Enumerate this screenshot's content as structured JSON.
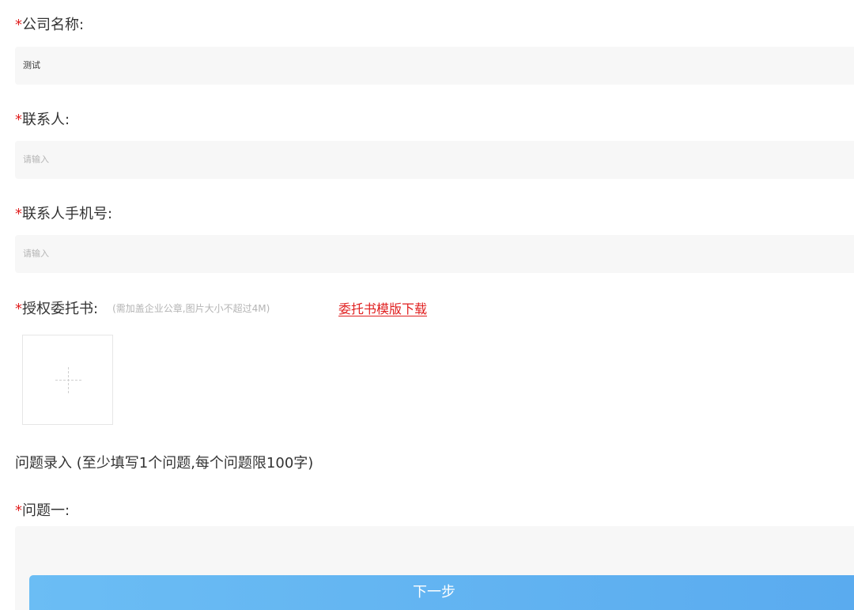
{
  "form": {
    "required_mark": "*",
    "company": {
      "label": "公司名称:",
      "value": "测试"
    },
    "contact": {
      "label": "联系人:",
      "placeholder": "请输入"
    },
    "phone": {
      "label": "联系人手机号:",
      "placeholder": "请输入"
    },
    "authorization": {
      "label": "授权委托书:",
      "hint": "(需加盖企业公章,图片大小不超过4M)",
      "template_link": "委托书模版下载",
      "upload_icon": "plus-icon"
    }
  },
  "questions": {
    "section_title": "问题录入 (至少填写1个问题,每个问题限100字)",
    "q1_label": "问题一:"
  },
  "actions": {
    "next_label": "下一步"
  },
  "colors": {
    "required": "#e02020",
    "link": "#e02020",
    "field_bg": "#f7f7f7",
    "button_start": "#6bbdf4",
    "button_end": "#5aabef"
  }
}
